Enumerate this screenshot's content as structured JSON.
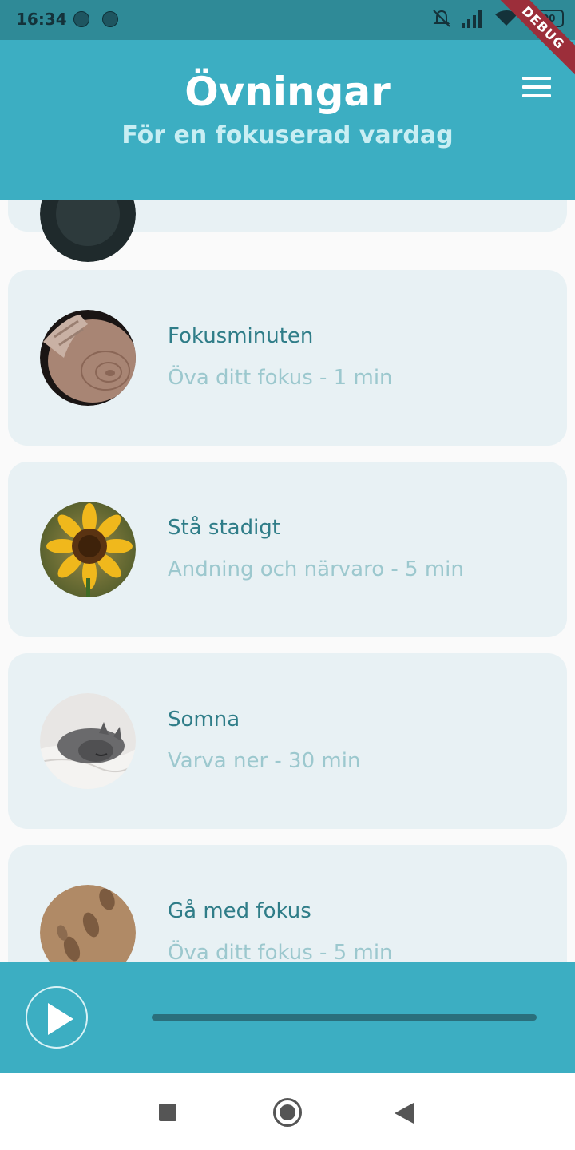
{
  "status_bar": {
    "time": "16:34",
    "battery": "100",
    "debug_banner": "DEBUG"
  },
  "app_bar": {
    "title": "Övningar",
    "subtitle": "För en fokuserad vardag",
    "menu_icon": "hamburger-menu-icon"
  },
  "exercises": [
    {
      "title": "Fokusminuten",
      "subtitle": "Öva ditt fokus - 1 min",
      "image": "pottery-wheel"
    },
    {
      "title": "Stå stadigt",
      "subtitle": "Andning och närvaro - 5 min",
      "image": "sunflower"
    },
    {
      "title": "Somna",
      "subtitle": "Varva ner - 30 min",
      "image": "sleeping-cat"
    },
    {
      "title": "Gå med fokus",
      "subtitle": "Öva ditt fokus - 5 min",
      "image": "footprints-in-sand"
    }
  ],
  "player": {
    "play_icon": "play-icon",
    "progress": 0
  },
  "colors": {
    "primary": "#3caec2",
    "status_bar": "#2f8a97",
    "card_background": "#e8f1f4",
    "card_title": "#2f7d88",
    "card_subtitle": "#9cc8ce"
  }
}
